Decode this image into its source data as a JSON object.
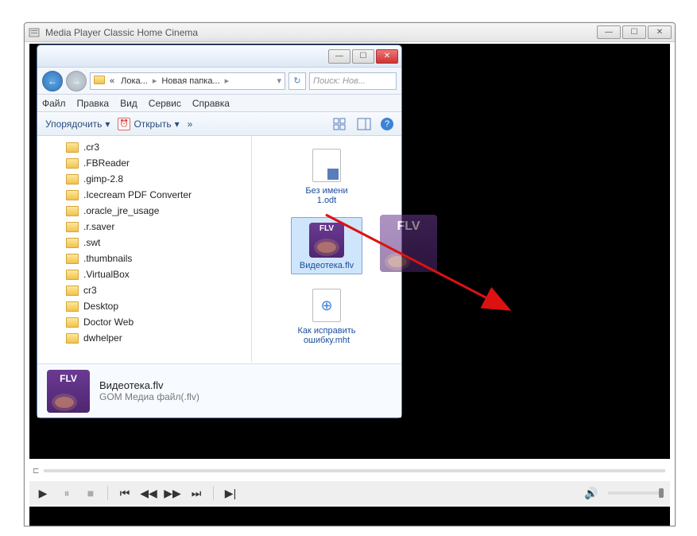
{
  "mpc": {
    "title": "Media Player Classic Home Cinema"
  },
  "explorer": {
    "breadcrumb": {
      "root": "«",
      "disk": "Лока...",
      "folder": "Новая папка..."
    },
    "search_placeholder": "Поиск: Нов...",
    "menu": {
      "file": "Файл",
      "edit": "Правка",
      "view": "Вид",
      "tools": "Сервис",
      "help": "Справка"
    },
    "toolbar": {
      "organize": "Упорядочить",
      "open": "Открыть",
      "more": "»"
    },
    "tree": [
      ".cr3",
      ".FBReader",
      ".gimp-2.8",
      ".Icecream PDF Converter",
      ".oracle_jre_usage",
      ".r.saver",
      ".swt",
      ".thumbnails",
      ".VirtualBox",
      "cr3",
      "Desktop",
      "Doctor Web",
      "dwhelper"
    ],
    "files": [
      {
        "name": "Без имени 1.odt",
        "type": "odt"
      },
      {
        "name": "Видеотека.flv",
        "type": "flv",
        "selected": true,
        "flv_label": "FLV"
      },
      {
        "name": "Как исправить ошибку.mht",
        "type": "mht"
      },
      {
        "name": "",
        "type": "xls"
      }
    ],
    "details": {
      "filename": "Видеотека.flv",
      "filetype": "GOM Медиа файл(.flv)",
      "flv_label": "FLV"
    }
  },
  "drag": {
    "flv_label": "FLV"
  }
}
